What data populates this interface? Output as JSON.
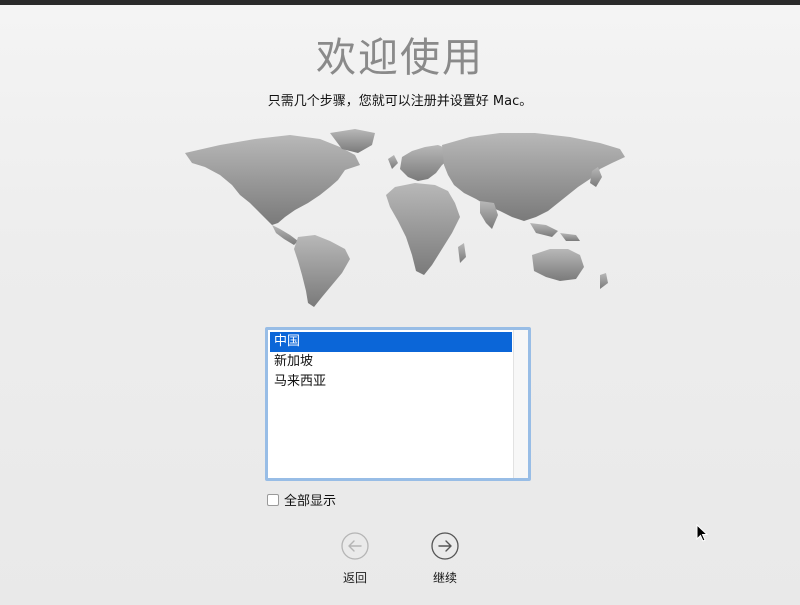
{
  "welcome": {
    "title": "欢迎使用",
    "subtitle": "只需几个步骤，您就可以注册并设置好 Mac。"
  },
  "country_list": {
    "items": [
      {
        "label": "中国",
        "selected": true
      },
      {
        "label": "新加坡",
        "selected": false
      },
      {
        "label": "马来西亚",
        "selected": false
      }
    ]
  },
  "show_all": {
    "label": "全部显示",
    "checked": false
  },
  "navigation": {
    "back_label": "返回",
    "continue_label": "继续"
  },
  "colors": {
    "selection": "#0b66d8",
    "list_focus_ring": "#98bde6",
    "title_gray": "#8a8a8a"
  },
  "icons": {
    "back": "arrow-left-circle-icon",
    "continue": "arrow-right-circle-icon",
    "map": "world-map"
  }
}
